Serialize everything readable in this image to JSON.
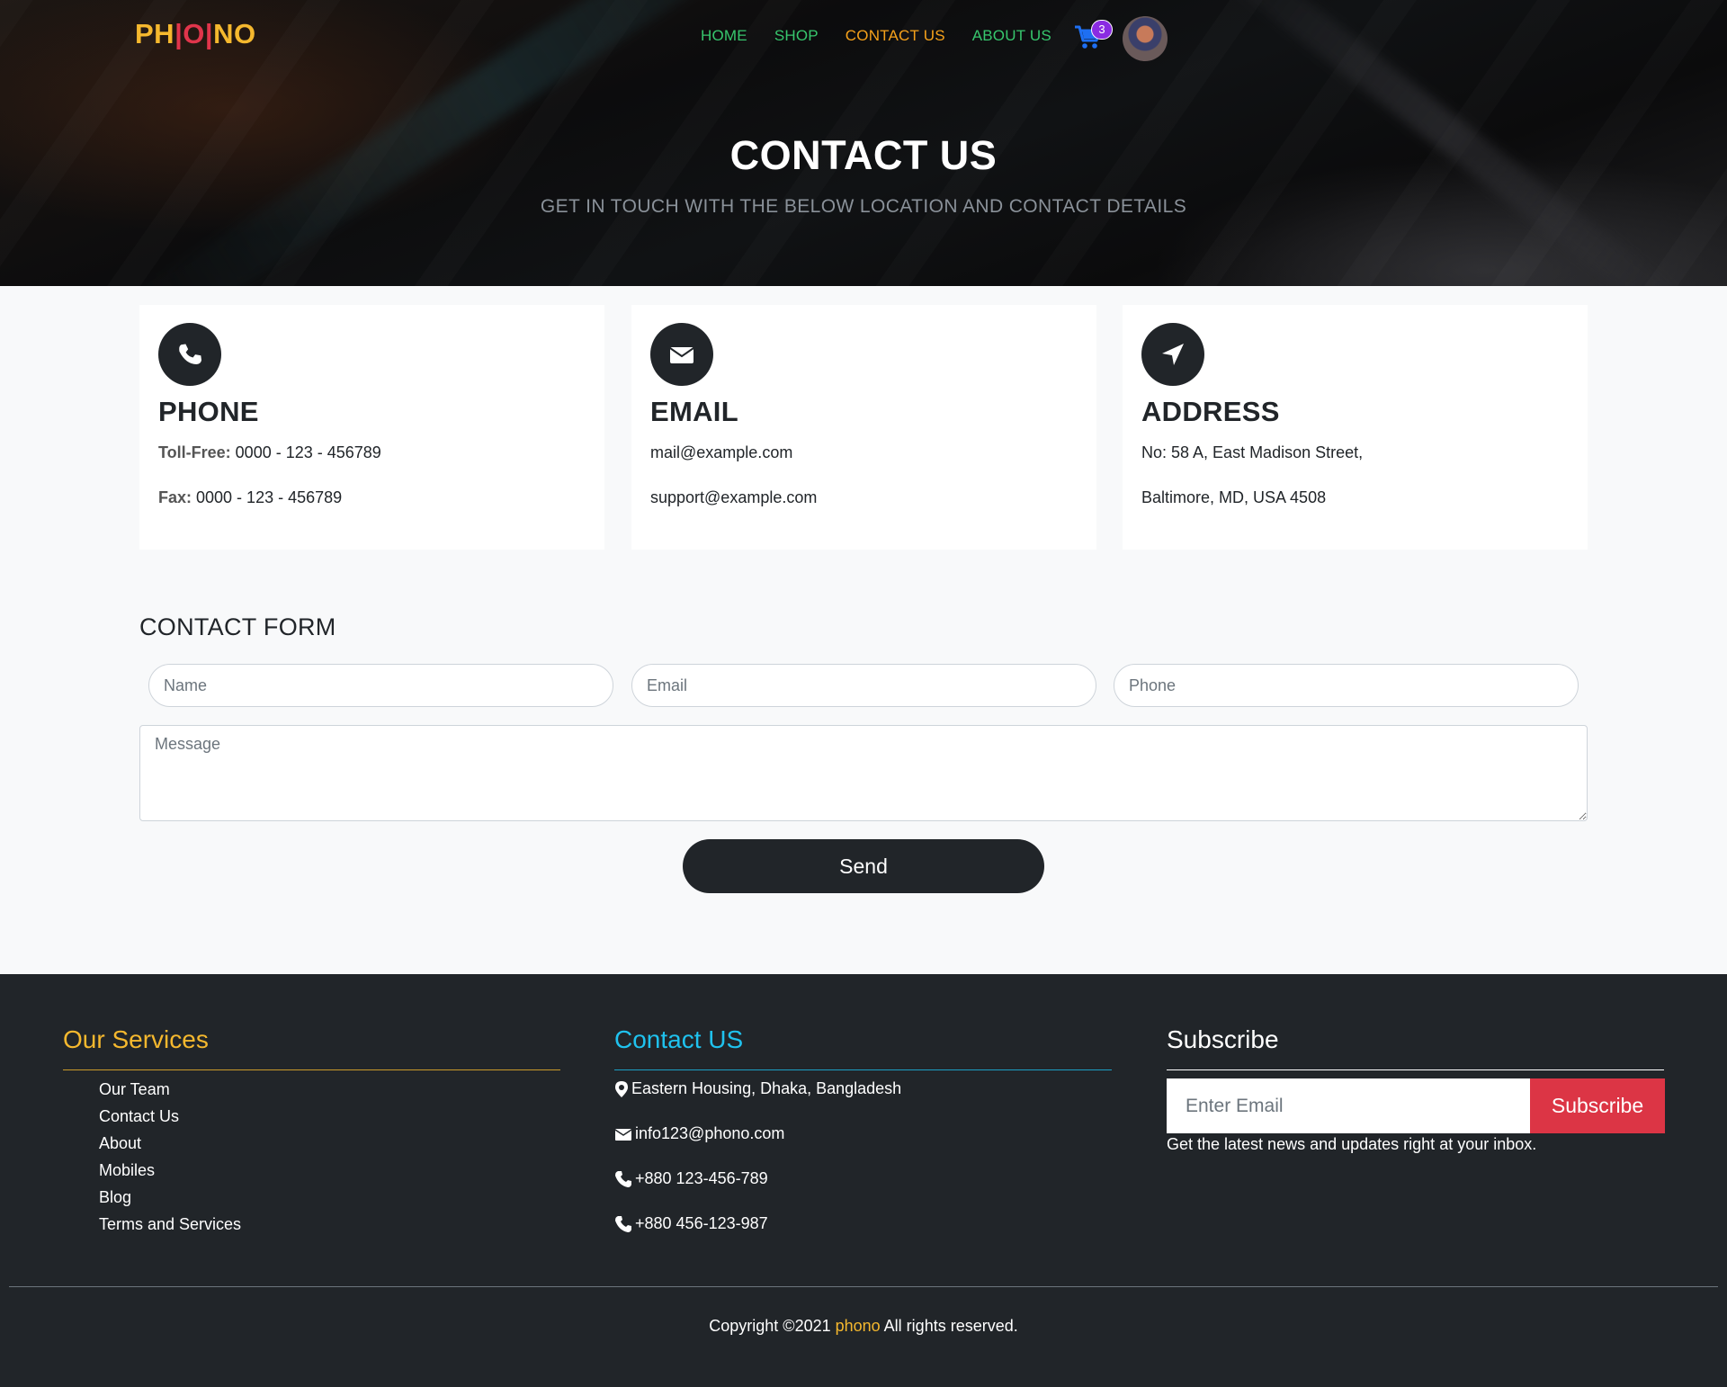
{
  "header": {
    "logo": {
      "p1": "PH",
      "sep1": "|",
      "p2": "O",
      "sep2": "|",
      "p3": "NO"
    },
    "nav": [
      {
        "label": "HOME",
        "active": false
      },
      {
        "label": "SHOP",
        "active": false
      },
      {
        "label": "CONTACT US",
        "active": true
      },
      {
        "label": "ABOUT US",
        "active": false
      }
    ],
    "cart_count": "3",
    "cart_icon": "cart-icon",
    "avatar_icon": "user-avatar"
  },
  "hero": {
    "title": "CONTACT US",
    "subtitle": "GET IN TOUCH WITH THE BELOW LOCATION AND CONTACT DETAILS"
  },
  "cards": [
    {
      "icon": "phone-icon",
      "title": "PHONE",
      "line1_label": "Toll-Free:",
      "line1_value": " 0000 - 123 - 456789",
      "line2_label": "Fax:",
      "line2_value": " 0000 - 123 - 456789"
    },
    {
      "icon": "envelope-icon",
      "title": "EMAIL",
      "line1_value": "mail@example.com",
      "line2_value": "support@example.com"
    },
    {
      "icon": "location-arrow-icon",
      "title": "ADDRESS",
      "line1_value": "No: 58 A, East Madison Street,",
      "line2_value": "Baltimore, MD, USA 4508"
    }
  ],
  "form": {
    "title": "CONTACT FORM",
    "name_placeholder": "Name",
    "email_placeholder": "Email",
    "phone_placeholder": "Phone",
    "message_placeholder": "Message",
    "send_label": "Send"
  },
  "footer": {
    "services": {
      "title": "Our Services",
      "color": "#f5b82e",
      "links": [
        "Our Team",
        "Contact Us",
        "About",
        "Mobiles",
        "Blog",
        "Terms and Services"
      ]
    },
    "contact": {
      "title": "Contact US",
      "color": "#1fc2ee",
      "items": [
        {
          "icon": "map-marker-icon",
          "text": "Eastern Housing, Dhaka, Bangladesh"
        },
        {
          "icon": "envelope-icon",
          "text": "info123@phono.com"
        },
        {
          "icon": "phone-icon",
          "text": "+880 123-456-789"
        },
        {
          "icon": "phone-icon",
          "text": "+880 456-123-987"
        }
      ]
    },
    "subscribe": {
      "title": "Subscribe",
      "placeholder": "Enter Email",
      "button": "Subscribe",
      "note": "Get the latest news and updates right at your inbox."
    },
    "copyright": {
      "prefix": "Copyright ©2021 ",
      "brand": "phono",
      "suffix": " All rights reserved."
    }
  }
}
